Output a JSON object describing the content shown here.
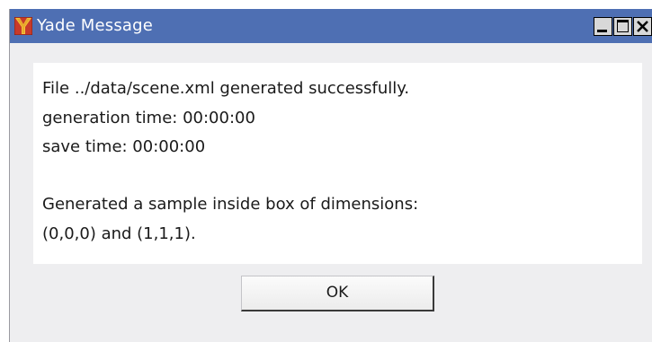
{
  "window": {
    "title": "Yade Message",
    "title_bar_color": "#4e6fb3",
    "app_icon": "yade-logo-icon",
    "controls": {
      "minimize_icon": "minimize-icon",
      "maximize_icon": "maximize-icon",
      "close_icon": "close-icon"
    }
  },
  "message": {
    "lines": [
      "File ../data/scene.xml generated successfully.",
      "generation time: 00:00:00",
      "save time: 00:00:00",
      "",
      "Generated a sample inside box of dimensions:",
      "(0,0,0) and (1,1,1)."
    ]
  },
  "buttons": {
    "ok_label": "OK"
  }
}
